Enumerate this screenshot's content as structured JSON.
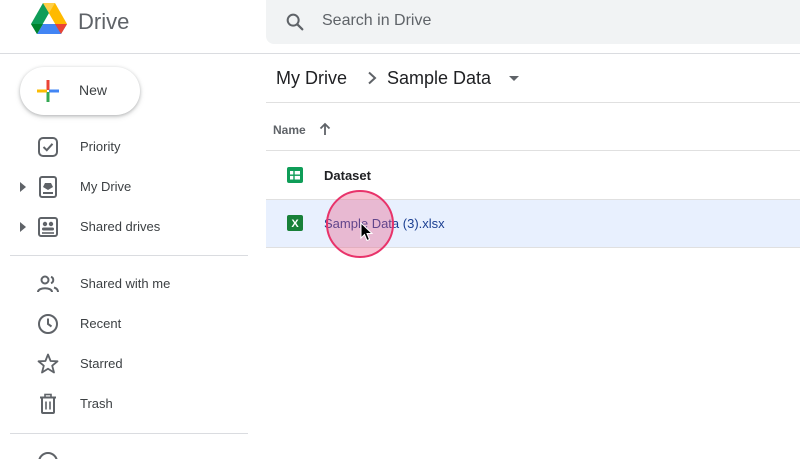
{
  "app": {
    "brand": "Drive"
  },
  "search": {
    "placeholder": "Search in Drive"
  },
  "new_button": {
    "label": "New"
  },
  "sidebar": {
    "items": [
      {
        "label": "Priority",
        "icon": "priority-icon"
      },
      {
        "label": "My Drive",
        "icon": "my-drive-icon"
      },
      {
        "label": "Shared drives",
        "icon": "shared-drives-icon"
      },
      {
        "label": "Shared with me",
        "icon": "shared-with-me-icon"
      },
      {
        "label": "Recent",
        "icon": "recent-icon"
      },
      {
        "label": "Starred",
        "icon": "starred-icon"
      },
      {
        "label": "Trash",
        "icon": "trash-icon"
      }
    ]
  },
  "breadcrumb": {
    "root": "My Drive",
    "current": "Sample Data"
  },
  "list": {
    "column_name": "Name",
    "sort": "ascending",
    "files": [
      {
        "name": "Dataset",
        "type": "google-sheets",
        "selected": false
      },
      {
        "name": "Sample Data (3).xlsx",
        "type": "excel",
        "selected": true
      }
    ]
  },
  "colors": {
    "selected_row": "#e8f0fe",
    "sheets_green": "#0f9d58",
    "excel_green": "#188038",
    "click_indicator": "#e8336a"
  }
}
